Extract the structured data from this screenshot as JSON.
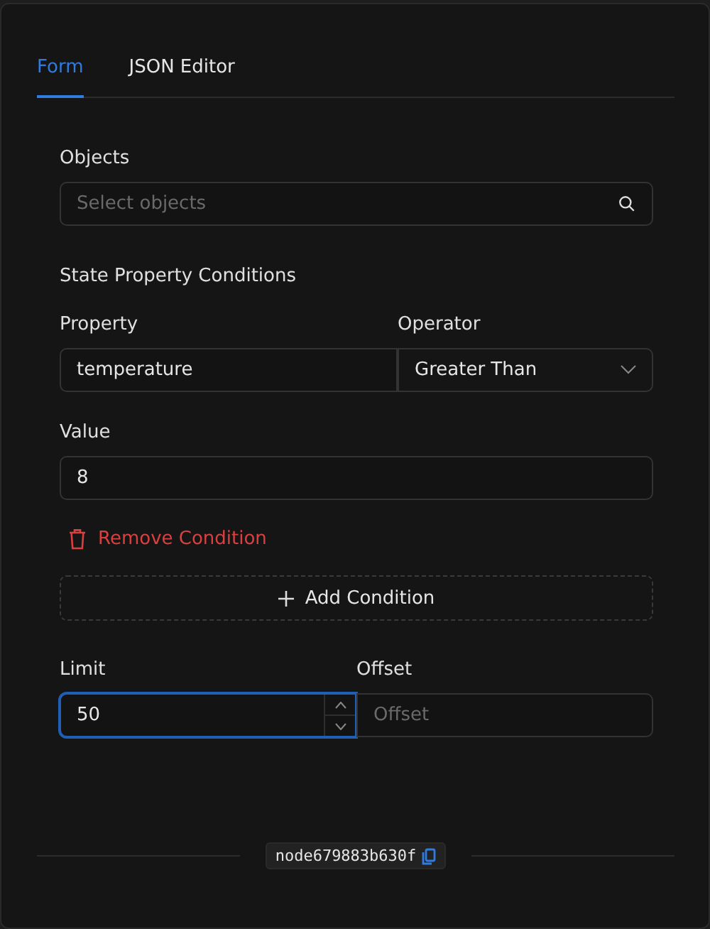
{
  "tabs": [
    {
      "label": "Form",
      "selected": true
    },
    {
      "label": "JSON Editor",
      "selected": false
    }
  ],
  "objects": {
    "label": "Objects",
    "placeholder": "Select objects"
  },
  "conditions": {
    "title": "State Property Conditions",
    "property_label": "Property",
    "operator_label": "Operator",
    "property": "temperature",
    "operator": "Greater Than",
    "value_label": "Value",
    "value": "8",
    "remove": "Remove Condition",
    "add": "Add Condition"
  },
  "limit": {
    "label": "Limit",
    "value": "50",
    "focused": true
  },
  "offset": {
    "label": "Offset",
    "placeholder": "Offset",
    "focused": false
  },
  "node_id": "node679883b630f"
}
